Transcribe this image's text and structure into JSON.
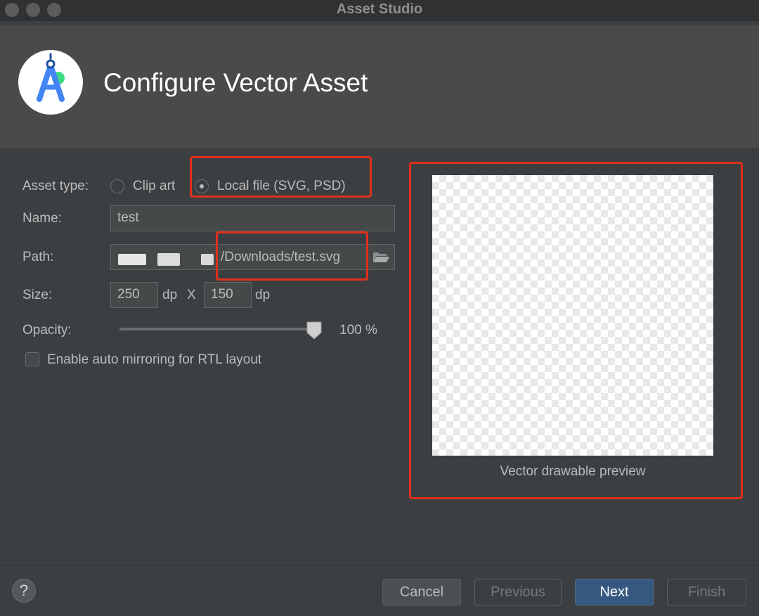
{
  "window": {
    "title": "Asset Studio"
  },
  "header": {
    "title": "Configure Vector Asset",
    "logo_icon": "android-studio-logo-icon"
  },
  "form": {
    "asset_type_label": "Asset type:",
    "asset_type_options": [
      {
        "label": "Clip art",
        "selected": false
      },
      {
        "label": "Local file (SVG, PSD)",
        "selected": true
      }
    ],
    "name_label": "Name:",
    "name_value": "test",
    "path_label": "Path:",
    "path_value": "/Downloads/test.svg",
    "browse_icon": "folder-open-icon",
    "size_label": "Size:",
    "width_value": "250",
    "width_unit": "dp",
    "size_separator": "X",
    "height_value": "150",
    "height_unit": "dp",
    "opacity_label": "Opacity:",
    "opacity_value": "100 %",
    "opacity_level": 1.0,
    "rtl_checkbox_label": "Enable auto mirroring for RTL layout",
    "rtl_checked": false
  },
  "preview": {
    "caption": "Vector drawable preview"
  },
  "footer": {
    "help_label": "?",
    "cancel_label": "Cancel",
    "previous_label": "Previous",
    "next_label": "Next",
    "finish_label": "Finish"
  },
  "colors": {
    "highlight": "#e0301e",
    "primary_button": "#365880",
    "background": "#3c3f41"
  }
}
